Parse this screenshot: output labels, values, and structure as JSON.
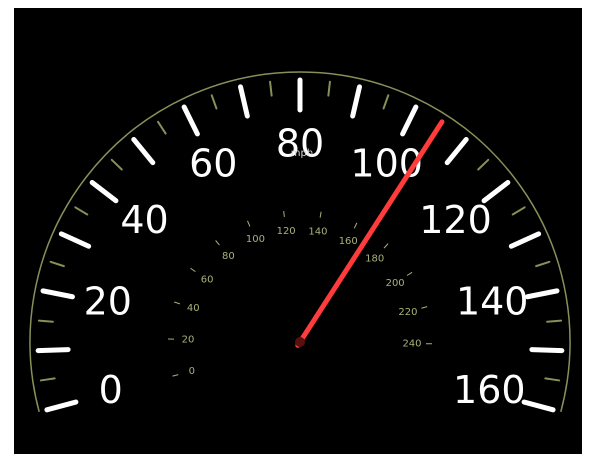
{
  "speedometer": {
    "unit": "mph",
    "mph_scale": [
      "0",
      "20",
      "40",
      "60",
      "80",
      "100",
      "120",
      "140",
      "160"
    ],
    "kmh_scale": [
      "0",
      "20",
      "40",
      "60",
      "80",
      "100",
      "120",
      "140",
      "160",
      "180",
      "200",
      "220",
      "240"
    ],
    "needle_mph": 105,
    "colors": {
      "background": "#000000",
      "scale_text": "#ffffff",
      "inner_scale_text": "#a9b07a",
      "inner_scale_highlight": "#7fbf4a",
      "needle": "#ff3b3b",
      "rim": "#8a8f5a"
    }
  }
}
